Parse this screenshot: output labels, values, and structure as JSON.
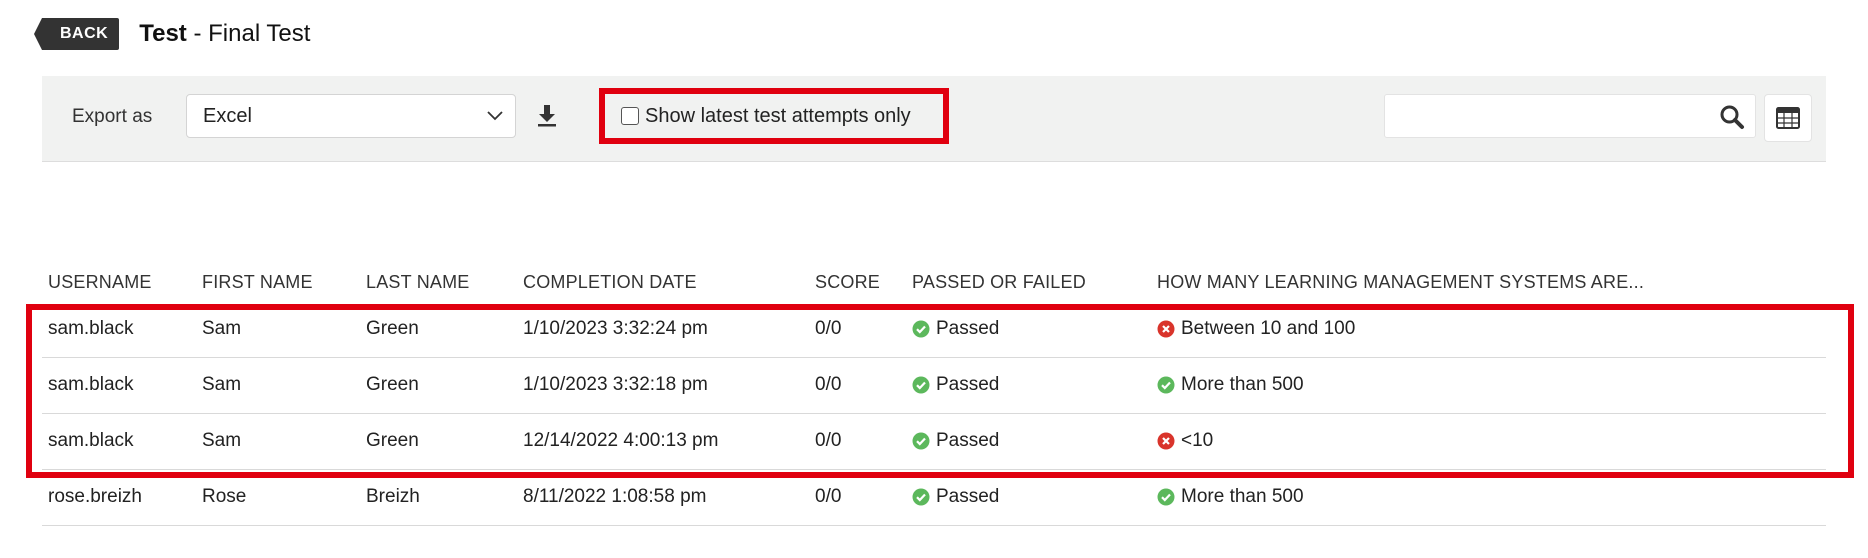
{
  "header": {
    "back_label": "BACK",
    "title_bold": "Test",
    "title_rest": " - Final Test"
  },
  "toolbar": {
    "export_label": "Export as",
    "export_value": "Excel",
    "latest_label": "Show latest test attempts only",
    "latest_checked": false,
    "search_value": "",
    "highlight_color": "#e0000f"
  },
  "icons": {
    "download": "download-icon",
    "search": "search-icon",
    "columns": "table-columns-icon",
    "passed": "check-circle-icon",
    "failed": "x-circle-icon"
  },
  "table": {
    "columns": [
      "USERNAME",
      "FIRST NAME",
      "LAST NAME",
      "COMPLETION DATE",
      "SCORE",
      "PASSED OR FAILED",
      "HOW MANY LEARNING MANAGEMENT SYSTEMS ARE..."
    ],
    "rows": [
      {
        "username": "sam.black",
        "first_name": "Sam",
        "last_name": "Green",
        "completion_date": "1/10/2023 3:32:24 pm",
        "score": "0/0",
        "result": "Passed",
        "result_status": "correct",
        "answer": "Between 10 and 100",
        "answer_status": "incorrect"
      },
      {
        "username": "sam.black",
        "first_name": "Sam",
        "last_name": "Green",
        "completion_date": "1/10/2023 3:32:18 pm",
        "score": "0/0",
        "result": "Passed",
        "result_status": "correct",
        "answer": "More than 500",
        "answer_status": "correct"
      },
      {
        "username": "sam.black",
        "first_name": "Sam",
        "last_name": "Green",
        "completion_date": "12/14/2022 4:00:13 pm",
        "score": "0/0",
        "result": "Passed",
        "result_status": "correct",
        "answer": "<10",
        "answer_status": "incorrect"
      },
      {
        "username": "rose.breizh",
        "first_name": "Rose",
        "last_name": "Breizh",
        "completion_date": "8/11/2022 1:08:58 pm",
        "score": "0/0",
        "result": "Passed",
        "result_status": "correct",
        "answer": "More than 500",
        "answer_status": "correct"
      }
    ]
  },
  "colors": {
    "pass_green": "#5cb85c",
    "fail_red": "#d9342b"
  }
}
